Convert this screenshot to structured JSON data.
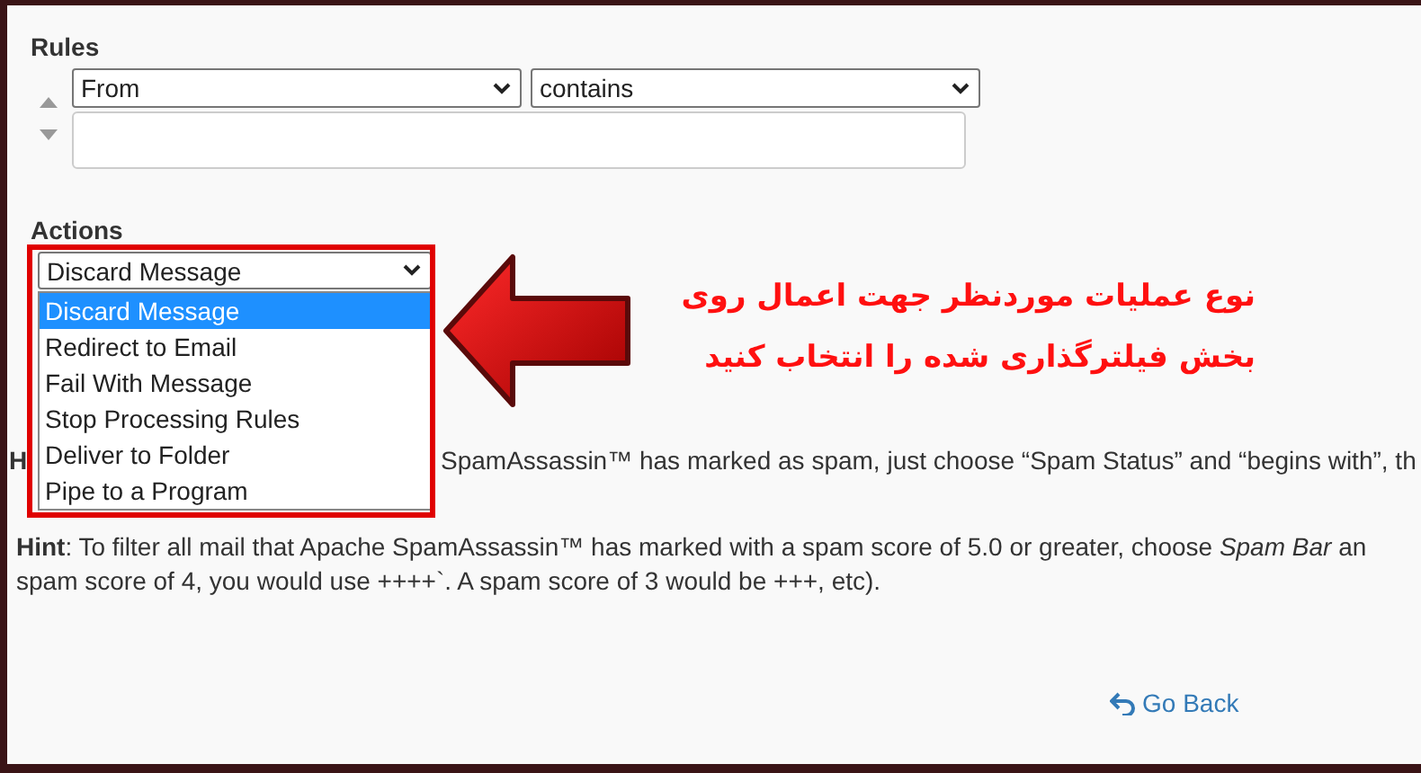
{
  "rules": {
    "title": "Rules",
    "field_select": "From",
    "operator_select": "contains"
  },
  "actions": {
    "title": "Actions",
    "select": "Discard Message",
    "options": [
      {
        "label": "Discard Message",
        "selected": true
      },
      {
        "label": "Redirect to Email",
        "selected": false
      },
      {
        "label": "Fail With Message",
        "selected": false
      },
      {
        "label": "Stop Processing Rules",
        "selected": false
      },
      {
        "label": "Deliver to Folder",
        "selected": false
      },
      {
        "label": "Pipe to a Program",
        "selected": false
      }
    ]
  },
  "annotation": {
    "lines": [
      "نوع عملیات موردنظر جهت اعمال روی",
      "بخش فیلترگذاری شده را انتخاب کنید"
    ]
  },
  "hint_1": {
    "lead": "H",
    "rest": "SpamAssassin™ has marked as spam, just choose “Spam Status” and “begins with”, th"
  },
  "hint_2": {
    "lines": [
      "**Hint**: To filter all mail that Apache SpamAssassin™ has marked with a spam score of 5.0 or greater, choose *Spam Bar* an",
      "spam score of 4, you would use ++++`. A spam score of 3 would be +++, etc)."
    ]
  },
  "go_back": "Go Back"
}
